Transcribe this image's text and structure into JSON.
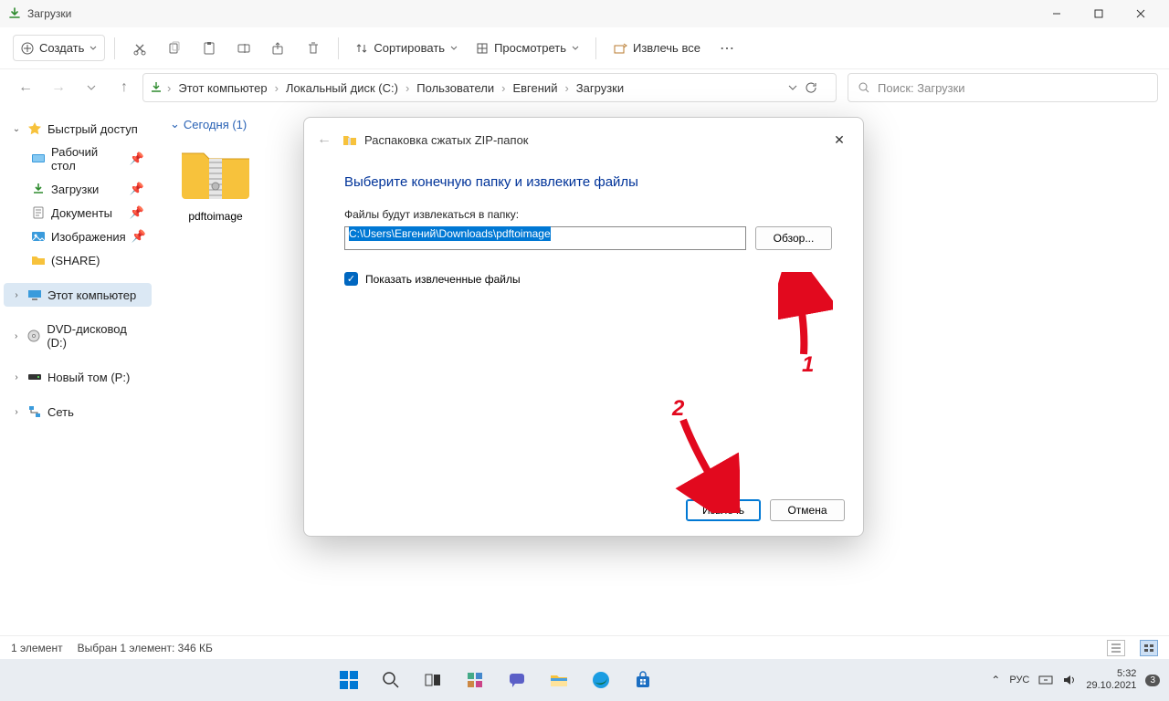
{
  "titlebar": {
    "title": "Загрузки"
  },
  "toolbar": {
    "new_label": "Создать",
    "sort_label": "Сортировать",
    "view_label": "Просмотреть",
    "extract_label": "Извлечь все"
  },
  "breadcrumb": {
    "items": [
      "Этот компьютер",
      "Локальный диск (C:)",
      "Пользователи",
      "Евгений",
      "Загрузки"
    ]
  },
  "search": {
    "placeholder": "Поиск: Загрузки"
  },
  "sidebar": {
    "quick_access": "Быстрый доступ",
    "desktop": "Рабочий стол",
    "downloads": "Загрузки",
    "documents": "Документы",
    "pictures": "Изображения",
    "share": "(SHARE)",
    "this_pc": "Этот компьютер",
    "dvd": "DVD-дисковод (D:)",
    "volume": "Новый том (P:)",
    "network": "Сеть"
  },
  "content": {
    "group_today": "Сегодня (1)",
    "file_name": "pdftoimage"
  },
  "statusbar": {
    "count": "1 элемент",
    "selection": "Выбран 1 элемент: 346 КБ"
  },
  "dialog": {
    "title": "Распаковка сжатых ZIP-папок",
    "heading": "Выберите конечную папку и извлеките файлы",
    "path_label": "Файлы будут извлекаться в папку:",
    "path_value": "C:\\Users\\Евгений\\Downloads\\pdftoimage",
    "browse": "Обзор...",
    "show_extracted": "Показать извлеченные файлы",
    "extract": "Извлечь",
    "cancel": "Отмена"
  },
  "annotations": {
    "num1": "1",
    "num2": "2"
  },
  "taskbar": {
    "lang": "РУС",
    "time": "5:32",
    "date": "29.10.2021",
    "notif": "3"
  }
}
